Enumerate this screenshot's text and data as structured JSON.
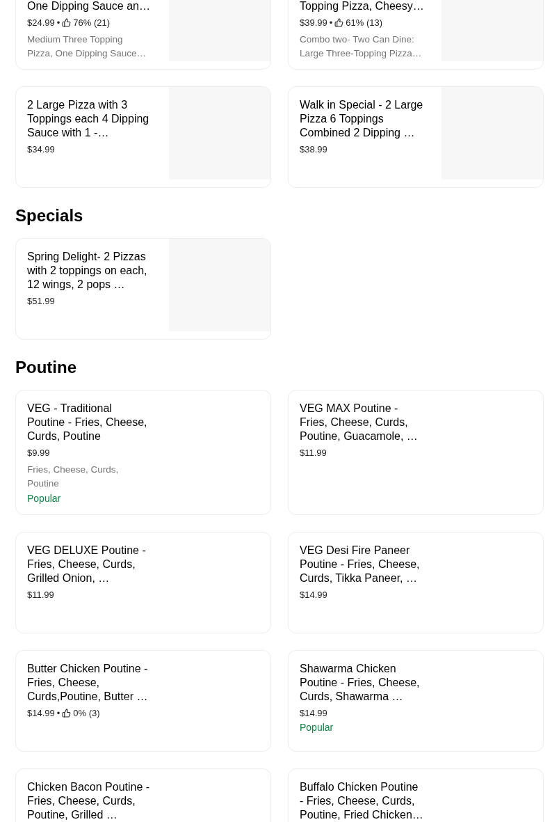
{
  "sections": [
    {
      "items": [
        {
          "title": "One Dipping Sauce an…",
          "price": "$24.99",
          "separator": "•",
          "rating": "76% (21)",
          "description": "Medium Three Topping Pizza, One Dipping Sauce…",
          "has_image": true
        },
        {
          "title": "Topping Pizza, Cheesy…",
          "price": "$39.99",
          "separator": "•",
          "rating": "61% (13)",
          "description": "Combo two- Two Can Dine: Large Three-Topping Pizza…",
          "has_image": true
        },
        {
          "title": "2 Large Pizza with 3 Toppings each 4 Dipping Sauce with 1 -…",
          "price": "$34.99",
          "has_image": true
        },
        {
          "title": "Walk in Special - 2 Large Pizza 6 Toppings Combined 2 Dipping …",
          "price": "$38.99",
          "has_image": true
        }
      ]
    },
    {
      "heading": "Specials",
      "items": [
        {
          "title": "Spring Delight- 2 Pizzas with 2 toppings on each, 12 wings, 2 pops …",
          "price": "$51.99",
          "has_image": true
        }
      ]
    },
    {
      "heading": "Poutine",
      "items": [
        {
          "title": "VEG - Traditional Poutine - Fries, Cheese, Curds, Poutine",
          "price": "$9.99",
          "description": "Fries, Cheese, Curds, Poutine",
          "badge": "Popular",
          "has_image": false
        },
        {
          "title": "VEG MAX Poutine - Fries, Cheese, Curds, Poutine, Guacamole, …",
          "price": "$11.99",
          "has_image": false
        },
        {
          "title": "VEG DELUXE Poutine - Fries, Cheese, Curds, Grilled Onion, …",
          "price": "$11.99",
          "has_image": false
        },
        {
          "title": "VEG Desi Fire Paneer Poutine - Fries, Cheese, Curds, Tikka Paneer, …",
          "price": "$14.99",
          "has_image": false
        },
        {
          "title": "Butter Chicken Poutine - Fries, Cheese, Curds,Poutine, Butter …",
          "price": "$14.99",
          "separator": "•",
          "rating": "0% (3)",
          "has_image": false
        },
        {
          "title": "Shawarma Chicken Poutine - Fries, Cheese, Curds, Shawarma …",
          "price": "$14.99",
          "badge": "Popular",
          "has_image": false
        },
        {
          "title": "Chicken Bacon Poutine - Fries, Cheese, Curds, Poutine, Grilled …",
          "has_image": false
        },
        {
          "title": "Buffalo Chicken Poutine - Fries, Cheese, Curds, Poutine, Fried Chicken…",
          "has_image": false
        }
      ]
    }
  ]
}
